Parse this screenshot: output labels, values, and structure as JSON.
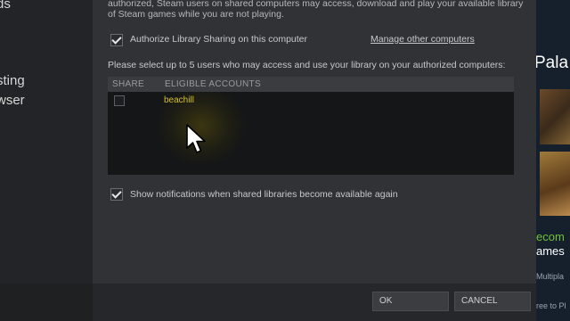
{
  "left_menu": {
    "items": [
      "ds",
      "sting",
      "wser"
    ]
  },
  "dialog": {
    "description_line1": "authorized, Steam users on shared computers may access, download and play your available library",
    "description_line2": "of Steam games while you are not playing.",
    "authorize_label": "Authorize Library Sharing on this computer",
    "authorize_checked": true,
    "manage_link": "Manage other computers",
    "select_prompt": "Please select up to 5 users who may access and use your library on your authorized computers:",
    "table": {
      "columns": [
        "SHARE",
        "ELIGIBLE ACCOUNTS"
      ],
      "rows": [
        {
          "share": false,
          "account": "beachill"
        }
      ]
    },
    "notify_label": "Show notifications when shared libraries become available again",
    "notify_checked": true,
    "ok_label": "OK",
    "cancel_label": "CANCEL"
  },
  "right_panel": {
    "title_fragment": "Pala",
    "text_green": "ecom",
    "text_white": "ames",
    "text_small1": "Multipla",
    "text_small2": "ree to Pl"
  },
  "colors": {
    "dialog_bg": "#303236",
    "account_yellow": "#d4c02a",
    "green_text": "#6fc23a"
  }
}
